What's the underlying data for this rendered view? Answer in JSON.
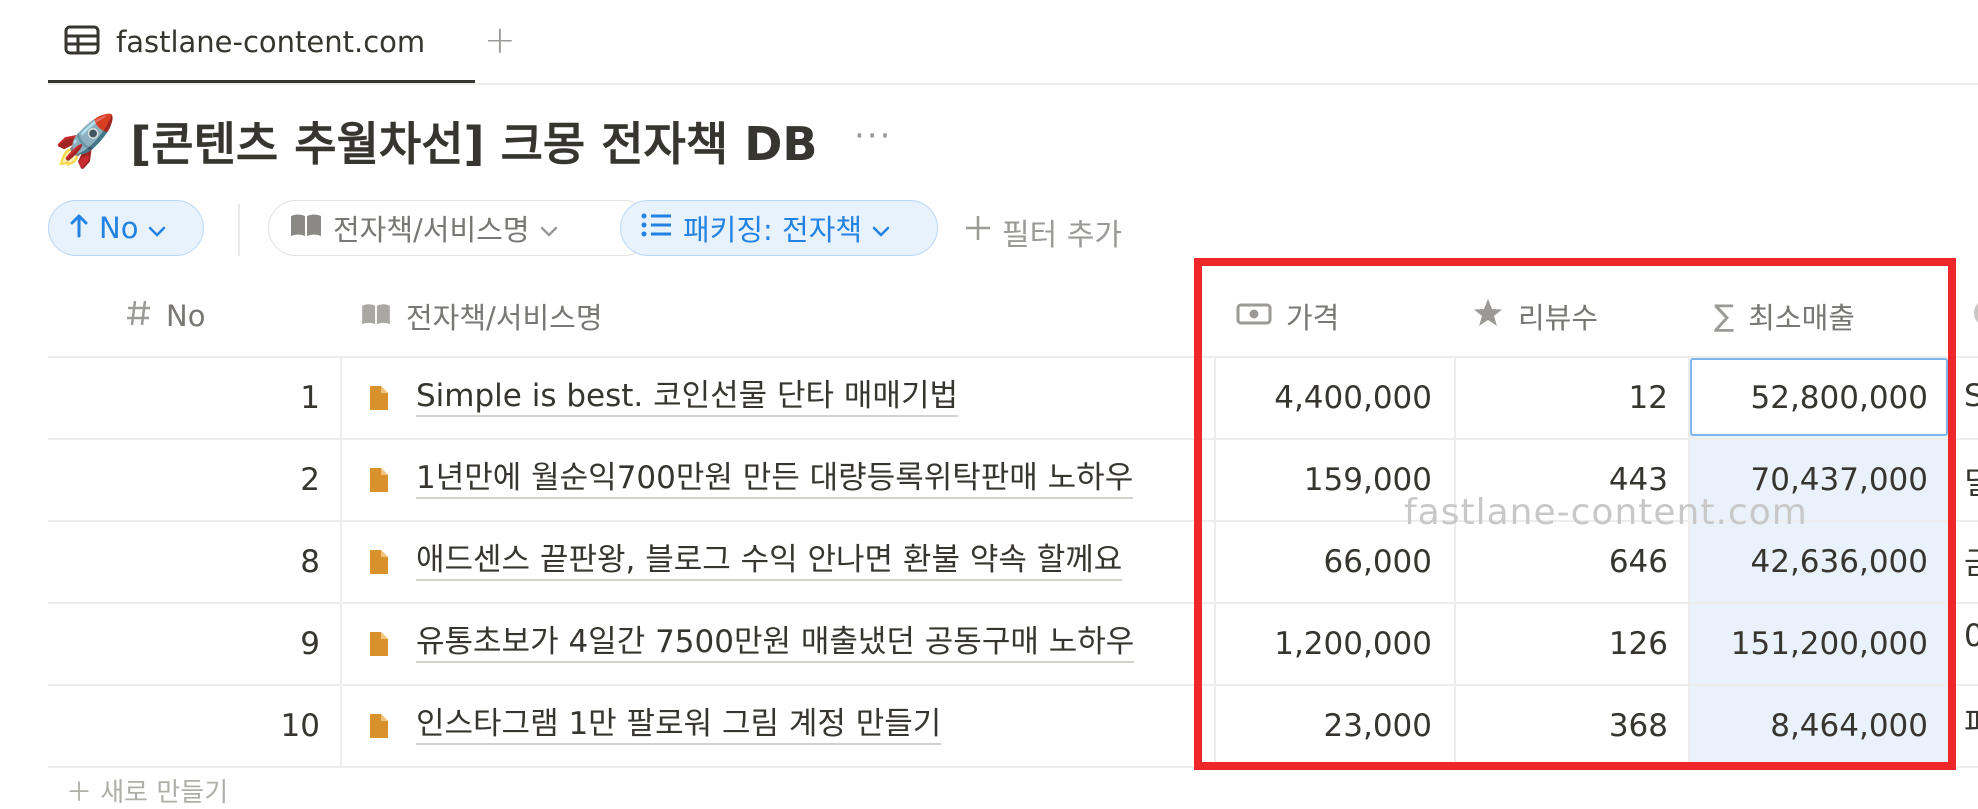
{
  "tab": {
    "label": "fastlane-content.com",
    "add_icon": "+"
  },
  "page": {
    "emoji": "🚀",
    "title": "[콘텐츠 추월차선] 크몽 전자책 DB",
    "more": "···"
  },
  "filters": {
    "sort_label": "No",
    "name_filter_label": "전자책/서비스명",
    "packaging_filter_label": "패키징: 전자책",
    "add_filter_label": "필터 추가"
  },
  "columns": {
    "no": "No",
    "name": "전자책/서비스명",
    "price": "가격",
    "reviews": "리뷰수",
    "min_sales": "최소매출"
  },
  "rows": [
    {
      "no": "1",
      "name": "Simple is best. 코인선물 단타 매매기법",
      "price": "4,400,000",
      "reviews": "12",
      "min_sales": "52,800,000"
    },
    {
      "no": "2",
      "name": "1년만에 월순익700만원 만든 대량등록위탁판매 노하우",
      "price": "159,000",
      "reviews": "443",
      "min_sales": "70,437,000"
    },
    {
      "no": "8",
      "name": "애드센스 끝판왕, 블로그 수익 안나면 환불 약속 할께요",
      "price": "66,000",
      "reviews": "646",
      "min_sales": "42,636,000"
    },
    {
      "no": "9",
      "name": "유통초보가 4일간 7500만원 매출냈던 공동구매 노하우",
      "price": "1,200,000",
      "reviews": "126",
      "min_sales": "151,200,000"
    },
    {
      "no": "10",
      "name": "인스타그램 1만 팔로워 그림 계정 만들기",
      "price": "23,000",
      "reviews": "368",
      "min_sales": "8,464,000"
    }
  ],
  "watermark": "fastlane-content.com",
  "colors": {
    "accent": "#2383e2",
    "highlight": "#f0272a"
  }
}
